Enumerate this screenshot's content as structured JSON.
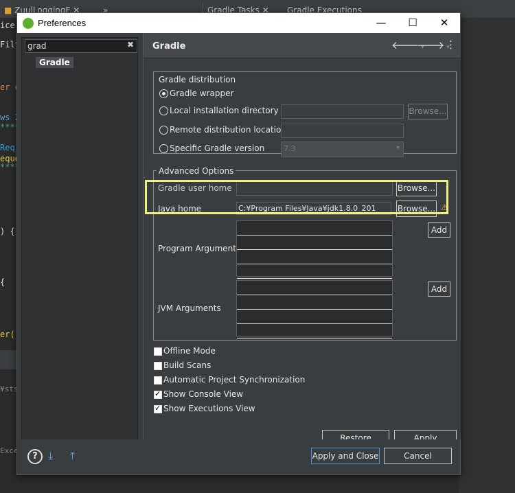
{
  "ide": {
    "tabs": [
      "ZuulLoggingF",
      "Gradle Tasks",
      "Gradle Executions"
    ],
    "overflow": "»",
    "code_fragments": [
      "ice.",
      "Filt",
      "er e",
      "ws Z",
      "*****",
      "Req",
      "eque",
      "*****",
      ") {",
      "{",
      "er(",
      "¥sts",
      "Exce"
    ]
  },
  "dialog": {
    "title": "Preferences",
    "minimize": "—",
    "maximize": "☐",
    "close": "✕"
  },
  "left": {
    "filter_value": "grad",
    "filter_clear": "✖",
    "tree_item": "Gradle"
  },
  "page": {
    "title": "Gradle",
    "back_icon": "🡐",
    "forward_icon": "🡒",
    "menu_icon": "⋮",
    "dist_group": "Gradle distribution",
    "radio_wrapper": "Gradle wrapper",
    "radio_local": "Local installation directory",
    "radio_remote": "Remote distribution location",
    "radio_specific": "Specific Gradle version",
    "specific_version": "7.3",
    "browse": "Browse...",
    "adv_group": "Advanced Options",
    "gradle_user_home_label": "Gradle user home",
    "java_home_label": "Java home",
    "java_home_value": "C:¥Program Files¥Java¥jdk1.8.0_201",
    "program_args_label": "Program Arguments",
    "jvm_args_label": "JVM Arguments",
    "add": "Add",
    "checkboxes": [
      {
        "label": "Offline Mode",
        "checked": false
      },
      {
        "label": "Build Scans",
        "checked": false
      },
      {
        "label": "Automatic Project Synchronization",
        "checked": false
      },
      {
        "label": "Show Console View",
        "checked": true
      },
      {
        "label": "Show Executions View",
        "checked": true
      }
    ],
    "restore_defaults": "Restore Defaults",
    "apply": "Apply"
  },
  "footer": {
    "help_icon": "?",
    "apply_close": "Apply and Close",
    "cancel": "Cancel"
  }
}
